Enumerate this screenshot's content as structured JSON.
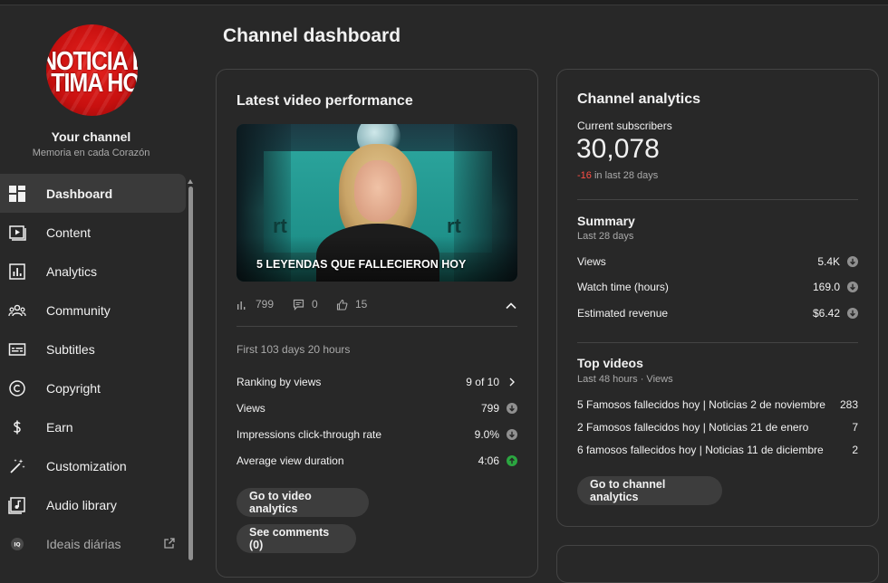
{
  "page_title": "Channel dashboard",
  "channel": {
    "logo_text_1": "NOTICIA DE",
    "logo_text_2": "TIMA HO",
    "name": "Your channel",
    "subtitle": "Memoria en cada Corazón"
  },
  "sidebar": {
    "items": [
      {
        "label": "Dashboard",
        "icon": "dashboard-icon",
        "active": true
      },
      {
        "label": "Content",
        "icon": "content-icon"
      },
      {
        "label": "Analytics",
        "icon": "analytics-icon"
      },
      {
        "label": "Community",
        "icon": "community-icon"
      },
      {
        "label": "Subtitles",
        "icon": "subtitles-icon"
      },
      {
        "label": "Copyright",
        "icon": "copyright-icon"
      },
      {
        "label": "Earn",
        "icon": "dollar-icon"
      },
      {
        "label": "Customization",
        "icon": "magic-wand-icon"
      },
      {
        "label": "Audio library",
        "icon": "audio-library-icon"
      },
      {
        "label": "Ideais diárias",
        "icon": "ideas-icon",
        "external": true
      }
    ]
  },
  "latest_video": {
    "card_title": "Latest video performance",
    "thumbnail": {
      "title": "5 LEYENDAS QUE FALLECIERON HOY",
      "rt_left": "rt",
      "rt_right": "rt"
    },
    "stats": {
      "views": "799",
      "comments": "0",
      "likes": "15"
    },
    "period": "First 103 days 20 hours",
    "rows": [
      {
        "label": "Ranking by views",
        "value": "9 of 10",
        "indicator": "chevron-right"
      },
      {
        "label": "Views",
        "value": "799",
        "indicator": "down"
      },
      {
        "label": "Impressions click-through rate",
        "value": "9.0%",
        "indicator": "down"
      },
      {
        "label": "Average view duration",
        "value": "4:06",
        "indicator": "up"
      }
    ],
    "buttons": {
      "analytics": "Go to video analytics",
      "comments": "See comments (0)"
    }
  },
  "channel_analytics": {
    "card_title": "Channel analytics",
    "subscribers_label": "Current subscribers",
    "subscribers_count": "30,078",
    "subscribers_delta": "-16",
    "subscribers_delta_suffix": "in last 28 days",
    "summary": {
      "title": "Summary",
      "period": "Last 28 days",
      "rows": [
        {
          "label": "Views",
          "value": "5.4K"
        },
        {
          "label": "Watch time (hours)",
          "value": "169.0"
        },
        {
          "label": "Estimated revenue",
          "value": "$6.42"
        }
      ]
    },
    "top_videos": {
      "title": "Top videos",
      "period": "Last 48 hours · Views",
      "rows": [
        {
          "title": "5 Famosos fallecidos hoy | Noticias 2 de noviembre",
          "views": "283"
        },
        {
          "title": "2 Famosos fallecidos hoy | Noticias 21 de enero",
          "views": "7"
        },
        {
          "title": "6 famosos fallecidos hoy | Noticias 11 de diciembre",
          "views": "2"
        }
      ]
    },
    "button": "Go to channel analytics"
  },
  "colors": {
    "background": "#282828",
    "card_border": "#444444",
    "text_secondary": "#aaaaaa",
    "negative": "#ff4e45",
    "positive": "#2ba640",
    "button_bg": "#3d3d3d"
  }
}
